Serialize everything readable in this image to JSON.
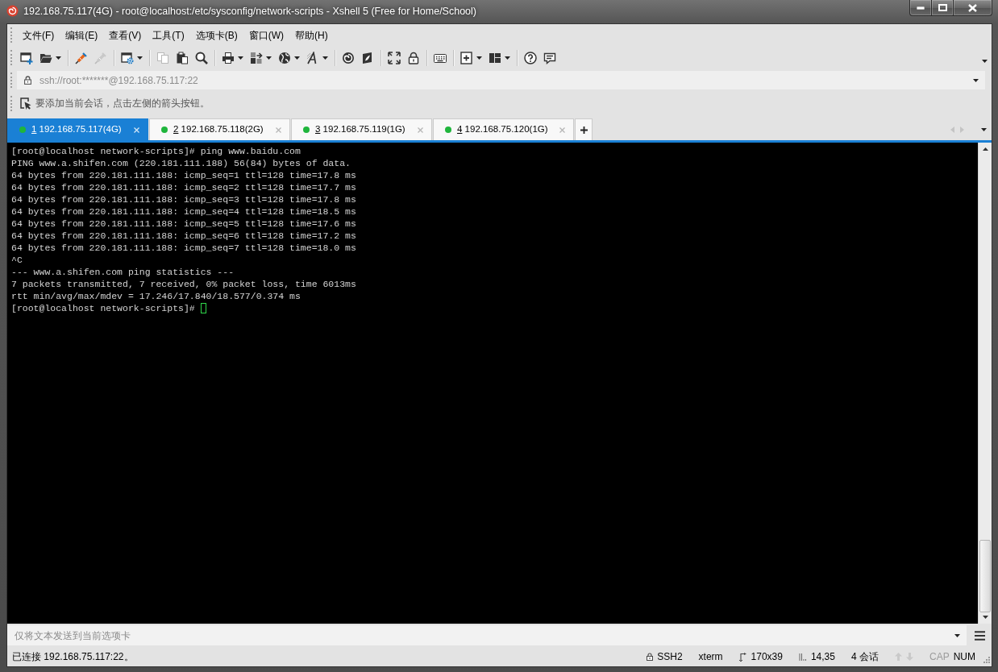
{
  "window": {
    "title": "192.168.75.117(4G) - root@localhost:/etc/sysconfig/network-scripts - Xshell 5 (Free for Home/School)"
  },
  "menu": [
    "文件(F)",
    "编辑(E)",
    "查看(V)",
    "工具(T)",
    "选项卡(B)",
    "窗口(W)",
    "帮助(H)"
  ],
  "toolbar": [
    [
      {
        "kind": "new",
        "disabled": false,
        "dropdown": false
      },
      {
        "kind": "open",
        "disabled": false,
        "dropdown": true
      }
    ],
    [
      {
        "kind": "connect",
        "disabled": false,
        "dropdown": false
      },
      {
        "kind": "disconnect",
        "disabled": true,
        "dropdown": false
      }
    ],
    [
      {
        "kind": "properties",
        "disabled": false,
        "dropdown": true
      }
    ],
    [
      {
        "kind": "copy",
        "disabled": true,
        "dropdown": false
      },
      {
        "kind": "paste",
        "disabled": false,
        "dropdown": false
      },
      {
        "kind": "find",
        "disabled": false,
        "dropdown": false
      }
    ],
    [
      {
        "kind": "print",
        "disabled": false,
        "dropdown": true
      },
      {
        "kind": "transfer",
        "disabled": false,
        "dropdown": true
      },
      {
        "kind": "globe",
        "disabled": false,
        "dropdown": true
      },
      {
        "kind": "font",
        "disabled": false,
        "dropdown": true
      }
    ],
    [
      {
        "kind": "swirl",
        "disabled": false,
        "dropdown": false
      },
      {
        "kind": "leaf",
        "disabled": false,
        "dropdown": false
      }
    ],
    [
      {
        "kind": "fullscreen",
        "disabled": false,
        "dropdown": false
      },
      {
        "kind": "lock",
        "disabled": false,
        "dropdown": false
      }
    ],
    [
      {
        "kind": "keyboard",
        "disabled": false,
        "dropdown": false
      }
    ],
    [
      {
        "kind": "addtab",
        "disabled": false,
        "dropdown": true
      },
      {
        "kind": "layout",
        "disabled": false,
        "dropdown": true
      }
    ],
    [
      {
        "kind": "help",
        "disabled": false,
        "dropdown": false
      },
      {
        "kind": "chat",
        "disabled": false,
        "dropdown": false
      }
    ]
  ],
  "address_bar": {
    "value": "ssh://root:*******@192.168.75.117:22"
  },
  "hint_bar": {
    "text": "要添加当前会话，点击左侧的箭头按钮。"
  },
  "tabs": [
    {
      "number": "1",
      "label": "192.168.75.117(4G)",
      "selected": true,
      "connected": true
    },
    {
      "number": "2",
      "label": "192.168.75.118(2G)",
      "selected": false,
      "connected": true
    },
    {
      "number": "3",
      "label": "192.168.75.119(1G)",
      "selected": false,
      "connected": true
    },
    {
      "number": "4",
      "label": "192.168.75.120(1G)",
      "selected": false,
      "connected": true
    }
  ],
  "tab_bar": {
    "scroll_disabled": true
  },
  "terminal": {
    "lines": [
      "[root@localhost network-scripts]# ping www.baidu.com",
      "PING www.a.shifen.com (220.181.111.188) 56(84) bytes of data.",
      "64 bytes from 220.181.111.188: icmp_seq=1 ttl=128 time=17.8 ms",
      "64 bytes from 220.181.111.188: icmp_seq=2 ttl=128 time=17.7 ms",
      "64 bytes from 220.181.111.188: icmp_seq=3 ttl=128 time=17.8 ms",
      "64 bytes from 220.181.111.188: icmp_seq=4 ttl=128 time=18.5 ms",
      "64 bytes from 220.181.111.188: icmp_seq=5 ttl=128 time=17.6 ms",
      "64 bytes from 220.181.111.188: icmp_seq=6 ttl=128 time=17.2 ms",
      "64 bytes from 220.181.111.188: icmp_seq=7 ttl=128 time=18.0 ms",
      "^C",
      "--- www.a.shifen.com ping statistics ---",
      "7 packets transmitted, 7 received, 0% packet loss, time 6013ms",
      "rtt min/avg/max/mdev = 17.246/17.840/18.577/0.374 ms",
      "[root@localhost network-scripts]#"
    ]
  },
  "compose_bar": {
    "placeholder": "仅将文本发送到当前选项卡"
  },
  "status_bar": {
    "message": "已连接 192.168.75.117:22。",
    "items": [
      {
        "kind": "protocol",
        "text": "SSH2"
      },
      {
        "kind": "terminal",
        "text": "xterm"
      },
      {
        "kind": "size",
        "text": "170x39"
      },
      {
        "kind": "position",
        "text": "14,35"
      },
      {
        "kind": "sessions",
        "text": "4 会话"
      },
      {
        "kind": "arrows",
        "disabled": true
      },
      {
        "kind": "key",
        "text": "CAP",
        "on": false
      },
      {
        "kind": "key",
        "text": "NUM",
        "on": true
      }
    ]
  }
}
